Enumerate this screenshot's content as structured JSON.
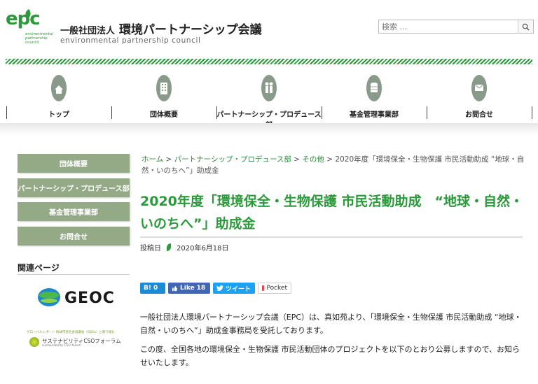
{
  "header": {
    "logo_mark": "epc",
    "logo_sub": "environmental partnership council",
    "org_prefix": "一般社団法人",
    "org_name": "環境パートナーシップ会議",
    "org_en": "environmental partnership council",
    "search_placeholder": "検索 …"
  },
  "nav": {
    "items": [
      {
        "label": "トップ",
        "icon": "home-icon"
      },
      {
        "label": "団体概要",
        "icon": "building-icon"
      },
      {
        "label": "パートナーシップ・プロデュース部",
        "icon": "people-icon"
      },
      {
        "label": "基金管理事業部",
        "icon": "coins-icon"
      },
      {
        "label": "お問合せ",
        "icon": "mail-icon"
      }
    ]
  },
  "sidebar": {
    "buttons": [
      "団体概要",
      "パートナーシップ・プロデュース部",
      "基金管理事業部",
      "お問合せ"
    ],
    "related_title": "関連ページ",
    "geoc_label": "GEOC",
    "cso_small": "グローバルレポート 地球市民社会協議会（SDGs）と取り組む",
    "cso_main": "サステナビリティCSOフォーラム",
    "cso_sub": "sustainability CSO forum"
  },
  "breadcrumb": {
    "home": "ホーム",
    "sep": " > ",
    "dept": "パートナーシップ・プロデュース部",
    "other": "その他",
    "current": "2020年度「環境保全・生物保護 市民活動助成 “地球・自然・いのちへ”」助成金"
  },
  "article": {
    "title": "2020年度「環境保全・生物保護 市民活動助成　“地球・自然・いのちへ”」助成金",
    "posted_label": "投稿日",
    "posted_date": "2020年6月18日",
    "para1": "一般社団法人環境パートナーシップ会議（EPC）は、真如苑より、「環境保全・生物保護 市民活動助成 “地球・自然・いのちへ”」助成金事務局を受託しております。",
    "para2": "この度、全国各地の環境保全・生物保護 市民活動団体のプロジェクトを以下のとおり公募しますので、お知らせいたします。"
  },
  "share": {
    "hatena": "B!",
    "hatena_count": "0",
    "like": "Like",
    "like_count": "18",
    "tweet": "ツイート",
    "pocket": "Pocket"
  },
  "colors": {
    "brand_green": "#2a9a3a",
    "sidebar_button": "#94a986"
  }
}
